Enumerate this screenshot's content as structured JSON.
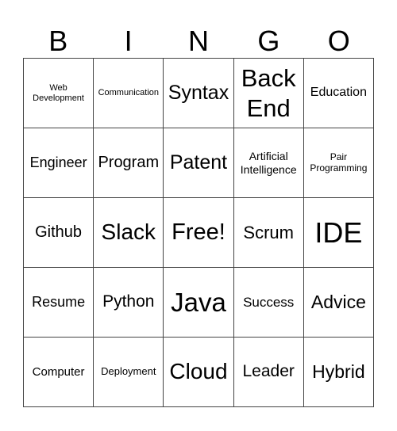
{
  "header": {
    "letters": [
      "B",
      "I",
      "N",
      "G",
      "O"
    ]
  },
  "board": {
    "rows": [
      [
        "Web Development",
        "Communication",
        "Syntax",
        "Back End",
        "Education"
      ],
      [
        "Engineer",
        "Program",
        "Patent",
        "Artificial Intelligence",
        "Pair Programming"
      ],
      [
        "Github",
        "Slack",
        "Free!",
        "Scrum",
        "IDE"
      ],
      [
        "Resume",
        "Python",
        "Java",
        "Success",
        "Advice"
      ],
      [
        "Computer",
        "Deployment",
        "Cloud",
        "Leader",
        "Hybrid"
      ]
    ]
  },
  "colors": {
    "text": "#000000",
    "grid_line": "#444444",
    "background": "#ffffff"
  }
}
